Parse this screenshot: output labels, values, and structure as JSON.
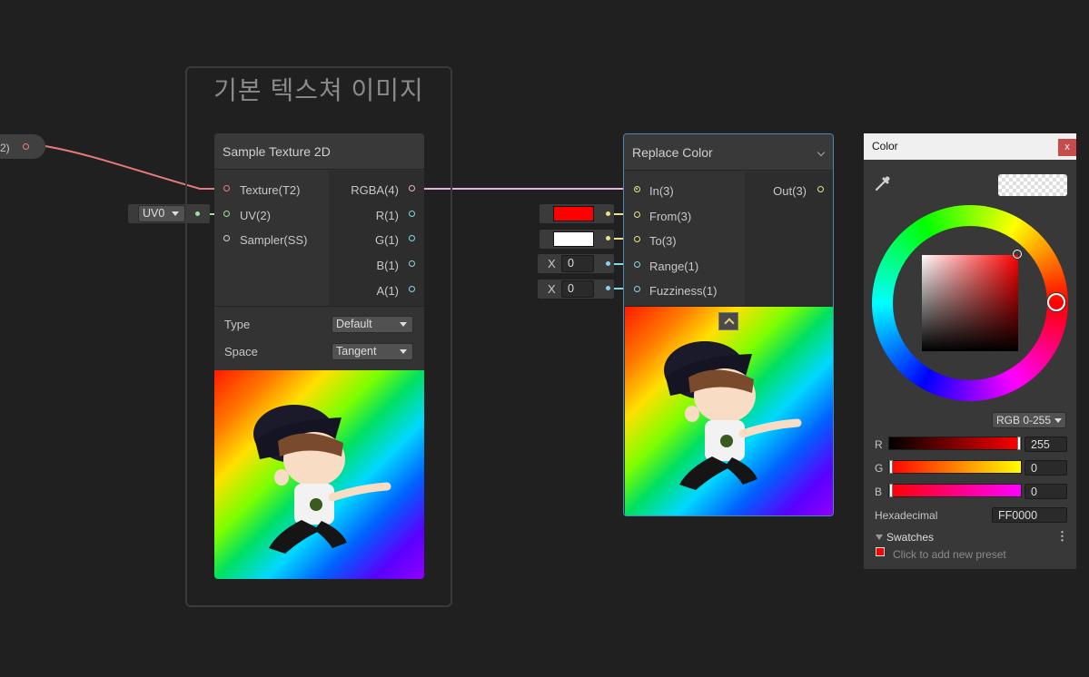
{
  "group": {
    "title": "기본 텍스쳐 이미지"
  },
  "property_chip": {
    "label": "2)"
  },
  "uv_dropdown": {
    "value": "UV0"
  },
  "sample_texture": {
    "title": "Sample Texture 2D",
    "inputs": [
      "Texture(T2)",
      "UV(2)",
      "Sampler(SS)"
    ],
    "outputs": [
      "RGBA(4)",
      "R(1)",
      "G(1)",
      "B(1)",
      "A(1)"
    ],
    "type_label": "Type",
    "type_value": "Default",
    "space_label": "Space",
    "space_value": "Tangent"
  },
  "replace_color": {
    "title": "Replace Color",
    "inputs": [
      "In(3)",
      "From(3)",
      "To(3)",
      "Range(1)",
      "Fuzziness(1)"
    ],
    "output": "Out(3)",
    "from_color": "#ff0000",
    "to_color": "#ffffff",
    "range_axis": "X",
    "range_value": "0",
    "fuzziness_axis": "X",
    "fuzziness_value": "0"
  },
  "color_window": {
    "title": "Color",
    "close": "x",
    "mode": "RGB 0-255",
    "r_label": "R",
    "r_value": "255",
    "r_level": 1.0,
    "g_label": "G",
    "g_value": "0",
    "g_level": 0.0,
    "b_label": "B",
    "b_value": "0",
    "b_level": 0.0,
    "hex_label": "Hexadecimal",
    "hex_value": "FF0000",
    "swatches_label": "Swatches",
    "swatches_hint": "Click to add new preset",
    "current_color": "#ff0000"
  },
  "colors": {
    "wire_texture": "#e87a7a",
    "wire_color": "#e8e6a0",
    "port_vector": "#e7e48b",
    "port_float": "#85d7e8",
    "port_texture": "#ee7b7b"
  }
}
